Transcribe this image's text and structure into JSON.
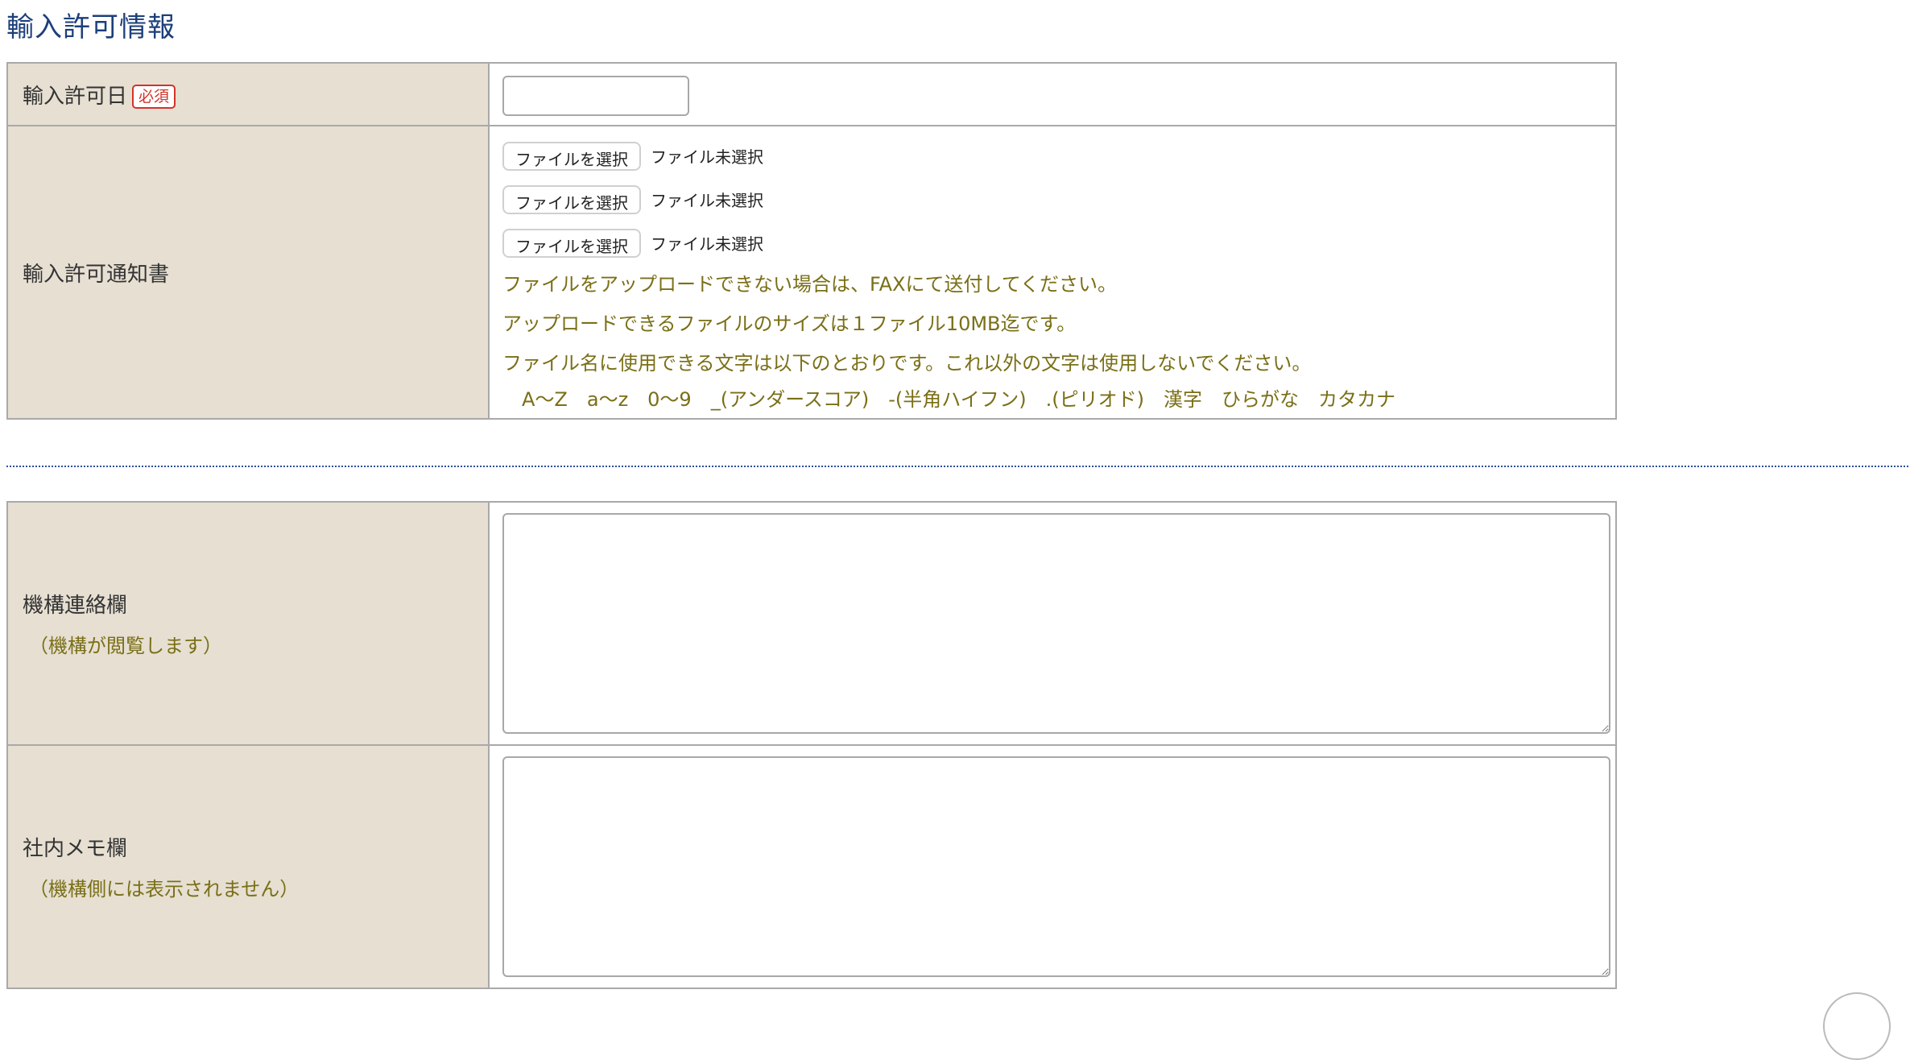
{
  "section_title": "輸入許可情報",
  "permit": {
    "date_label": "輸入許可日",
    "required_badge": "必須",
    "date_value": "",
    "notice_label": "輸入許可通知書",
    "files": [
      {
        "button": "ファイルを選択",
        "status": "ファイル未選択"
      },
      {
        "button": "ファイルを選択",
        "status": "ファイル未選択"
      },
      {
        "button": "ファイルを選択",
        "status": "ファイル未選択"
      }
    ],
    "notes": [
      "ファイルをアップロードできない場合は、FAXにて送付してください。",
      "アップロードできるファイルのサイズは１ファイル10MB迄です。",
      "ファイル名に使用できる文字は以下のとおりです。これ以外の文字は使用しないでください。"
    ],
    "allowed_chars": "A〜Z　a〜z　0〜9　_(アンダースコア)　-(半角ハイフン)　.(ピリオド)　漢字　ひらがな　カタカナ"
  },
  "memo": {
    "org_label": "機構連絡欄",
    "org_sub": "（機構が閲覧します）",
    "org_value": "",
    "internal_label": "社内メモ欄",
    "internal_sub": "（機構側には表示されません）",
    "internal_value": ""
  }
}
